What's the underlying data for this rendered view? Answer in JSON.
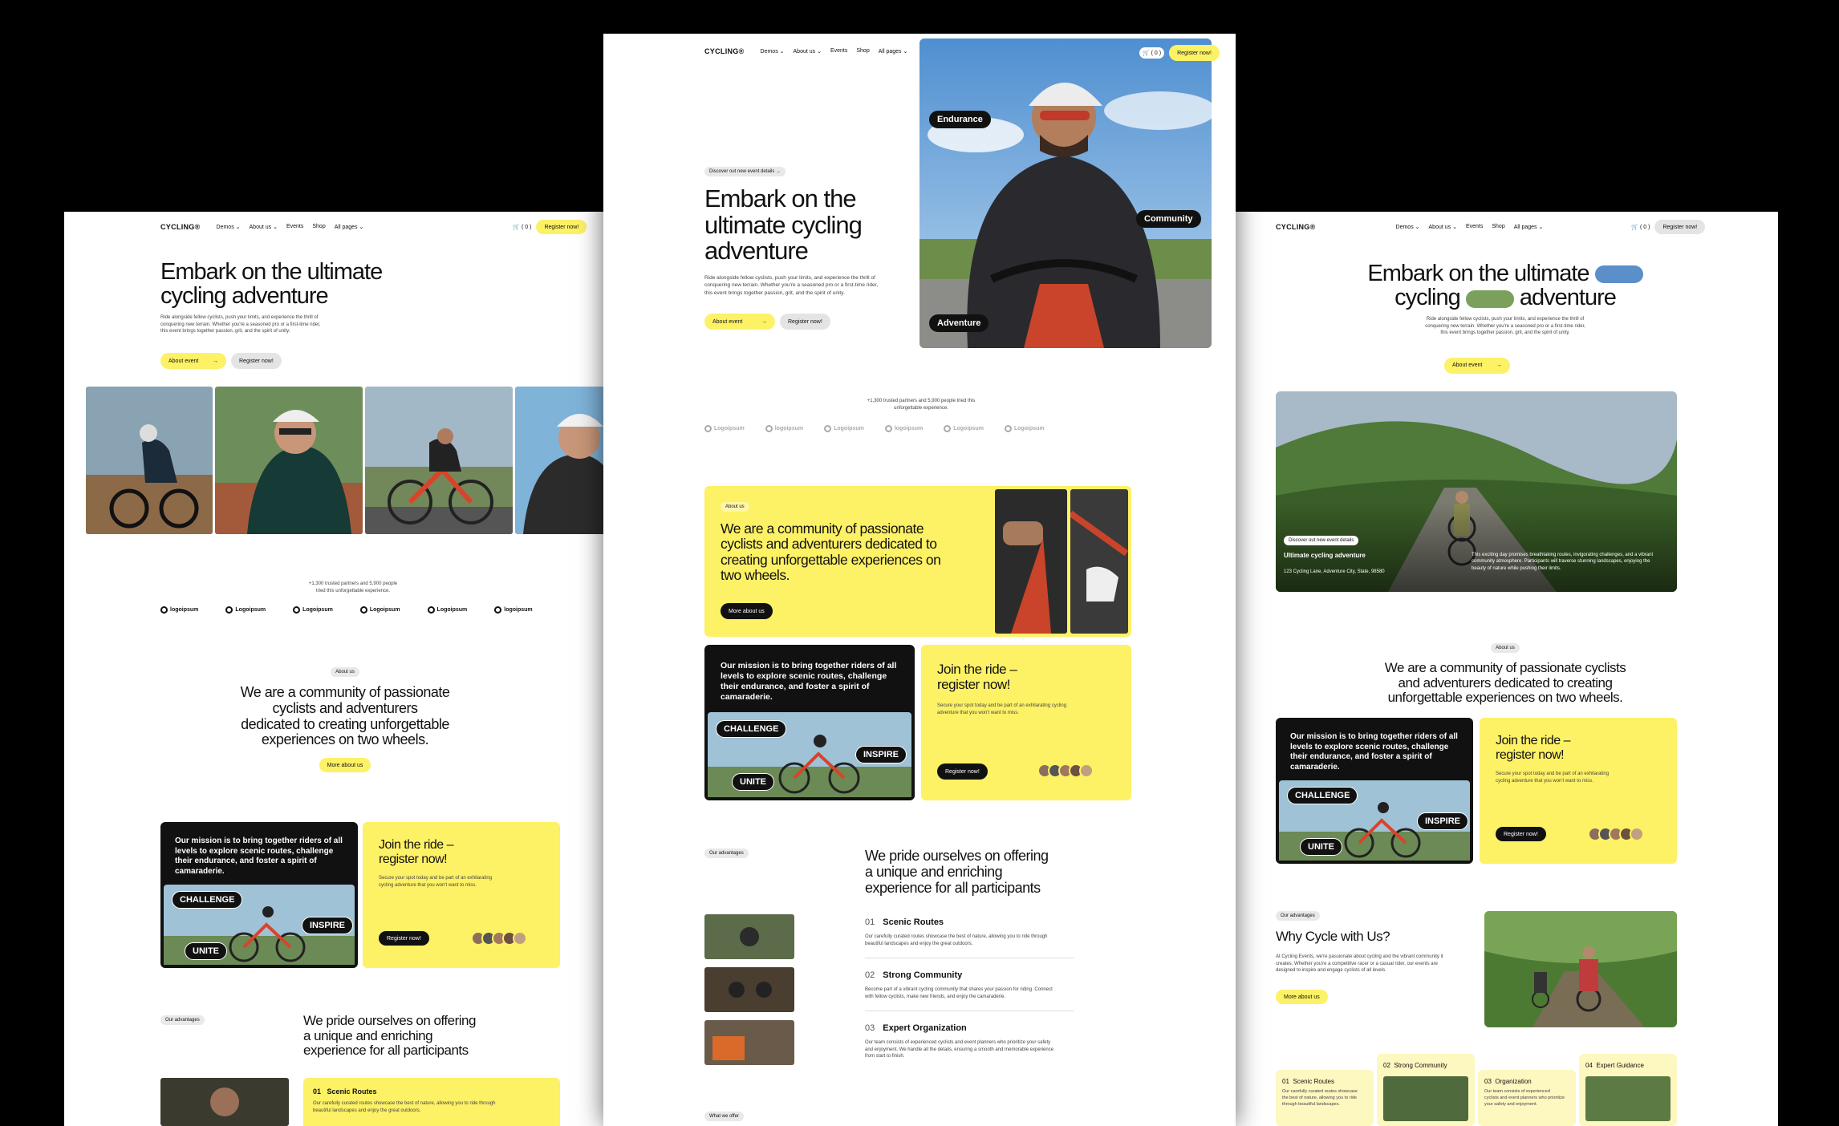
{
  "nav": {
    "logo": "CYCLING®",
    "links": [
      "Demos ⌄",
      "About us ⌄",
      "Events",
      "Shop",
      "All pages ⌄"
    ],
    "cart": "🛒 ( 0 )",
    "register": "Register now!"
  },
  "hero": {
    "line1": "Embark on the ultimate",
    "line2": "cycling adventure",
    "center_l1": "Embark on the",
    "center_l2": "ultimate cycling",
    "center_l3": "adventure",
    "right_l1": "Embark on the ultimate",
    "right_l2a": "cycling",
    "right_l2b": "adventure",
    "badge": "Discover out new event details",
    "body": "Ride alongside fellow cyclists, push your limits, and experience the thrill of conquering new terrain. Whether you're a seasoned pro or a first-time rider, this event brings together passion, grit, and the spirit of unity.",
    "about_btn": "About event",
    "register_btn": "Register now!",
    "tags": [
      "Endurance",
      "Community",
      "Adventure"
    ]
  },
  "trust": {
    "text": "+1,300 trusted partners and 5,900 people tried this unforgettable experience."
  },
  "logos": [
    "logoipsum",
    "Logoipsum",
    "Logoipsum",
    "Logoipsum",
    "Logoipsum",
    "logoipsum"
  ],
  "about": {
    "badge": "About us",
    "title": "We are a community of passionate cyclists and adventurers dedicated to creating unforgettable experiences on two wheels.",
    "l1": "We are a community of passionate",
    "l2": "cyclists and adventurers",
    "l3": "dedicated to creating unforgettable",
    "l4a": "experiences",
    "l4b": "on two wheels.",
    "r1": "We are a community of passionate cyclists",
    "r2": "and adventurers dedicated to creating",
    "r3": "unforgettable experiences on two wheels.",
    "more_btn": "More about us"
  },
  "mission": {
    "text": "Our mission is to bring together riders of all levels to explore scenic routes, challenge their endurance, and foster a spirit of camaraderie.",
    "stickers": [
      "CHALLENGE",
      "INSPIRE",
      "UNITE"
    ]
  },
  "join": {
    "title_l1": "Join the ride –",
    "title_l2": "register now!",
    "body": "Secure your spot today and be part of an exhilarating cycling adventure that you won't want to miss.",
    "button": "Register now!"
  },
  "advantages": {
    "badge": "Our advantages",
    "title_l1": "We pride ourselves on offering",
    "title_l2": "a unique and enriching",
    "title_l3": "experience for all participants",
    "items": [
      {
        "num": "01",
        "title": "Scenic Routes",
        "body": "Our carefully curated routes showcase the best of nature, allowing you to ride through beautiful landscapes and enjoy the great outdoors."
      },
      {
        "num": "02",
        "title": "Strong Community",
        "body": "Become part of a vibrant cycling community that shares your passion for riding. Connect with fellow cyclists, make new friends, and enjoy the camaraderie."
      },
      {
        "num": "03",
        "title": "Expert Organization",
        "body": "Our team consists of experienced cyclists and event planners who prioritize your safety and enjoyment. We handle all the details, ensuring a smooth and memorable experience from start to finish."
      }
    ],
    "what_we_offer": "What we offer"
  },
  "event_card": {
    "badge": "Discover out new event details",
    "title": "Ultimate cycling adventure",
    "address": "123 Cycling Lane, Adventure City, State, 98580",
    "desc": "This exciting day promises breathtaking routes, invigorating challenges, and a vibrant community atmosphere. Participants will traverse stunning landscapes, enjoying the beauty of nature while pushing their limits."
  },
  "why": {
    "title": "Why Cycle with Us?",
    "body": "At Cycling Events, we're passionate about cycling and the vibrant community it creates. Whether you're a competitive racer or a casual rider, our events are designed to inspire and engage cyclists of all levels.",
    "btn": "More about us"
  },
  "features": [
    {
      "num": "01",
      "title": "Scenic Routes",
      "body": "Our carefully curated routes showcase the best of nature, allowing you to ride through beautiful landscapes."
    },
    {
      "num": "02",
      "title": "Strong Community",
      "body": ""
    },
    {
      "num": "03",
      "title": "Organization",
      "body": "Our team consists of experienced cyclists and event planners who prioritize your safety and enjoyment."
    },
    {
      "num": "04",
      "title": "Expert Guidance",
      "body": ""
    }
  ],
  "colors": {
    "accent": "#fdf165",
    "dark": "#111111",
    "bg": "#000000"
  }
}
